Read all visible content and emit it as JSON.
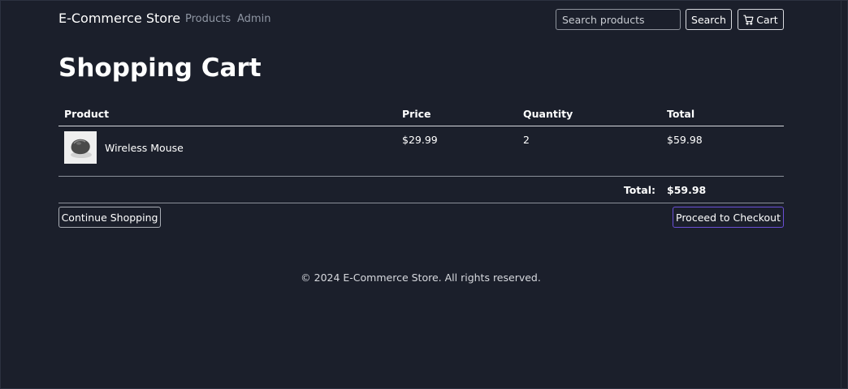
{
  "navbar": {
    "brand": "E-Commerce Store",
    "links": [
      "Products",
      "Admin"
    ],
    "search_placeholder": "Search products",
    "search_label": "Search",
    "cart_icon": "cart-icon",
    "cart_label": "Cart"
  },
  "page": {
    "title": "Shopping Cart"
  },
  "cart": {
    "headers": [
      "Product",
      "Price",
      "Quantity",
      "Total"
    ],
    "items": [
      {
        "image": "wireless-mouse-thumbnail",
        "name": "Wireless Mouse",
        "price": "$29.99",
        "quantity": "2",
        "total": "$59.98"
      }
    ],
    "grand_total_label": "Total:",
    "grand_total": "$59.98"
  },
  "actions": {
    "continue_label": "Continue Shopping",
    "checkout_label": "Proceed to Checkout"
  },
  "footer": {
    "text": "© 2024 E-Commerce Store. All rights reserved."
  },
  "colors": {
    "background": "#1b1f2b",
    "checkout_border": "#6a4fd6",
    "muted_link": "#8f96a3"
  }
}
